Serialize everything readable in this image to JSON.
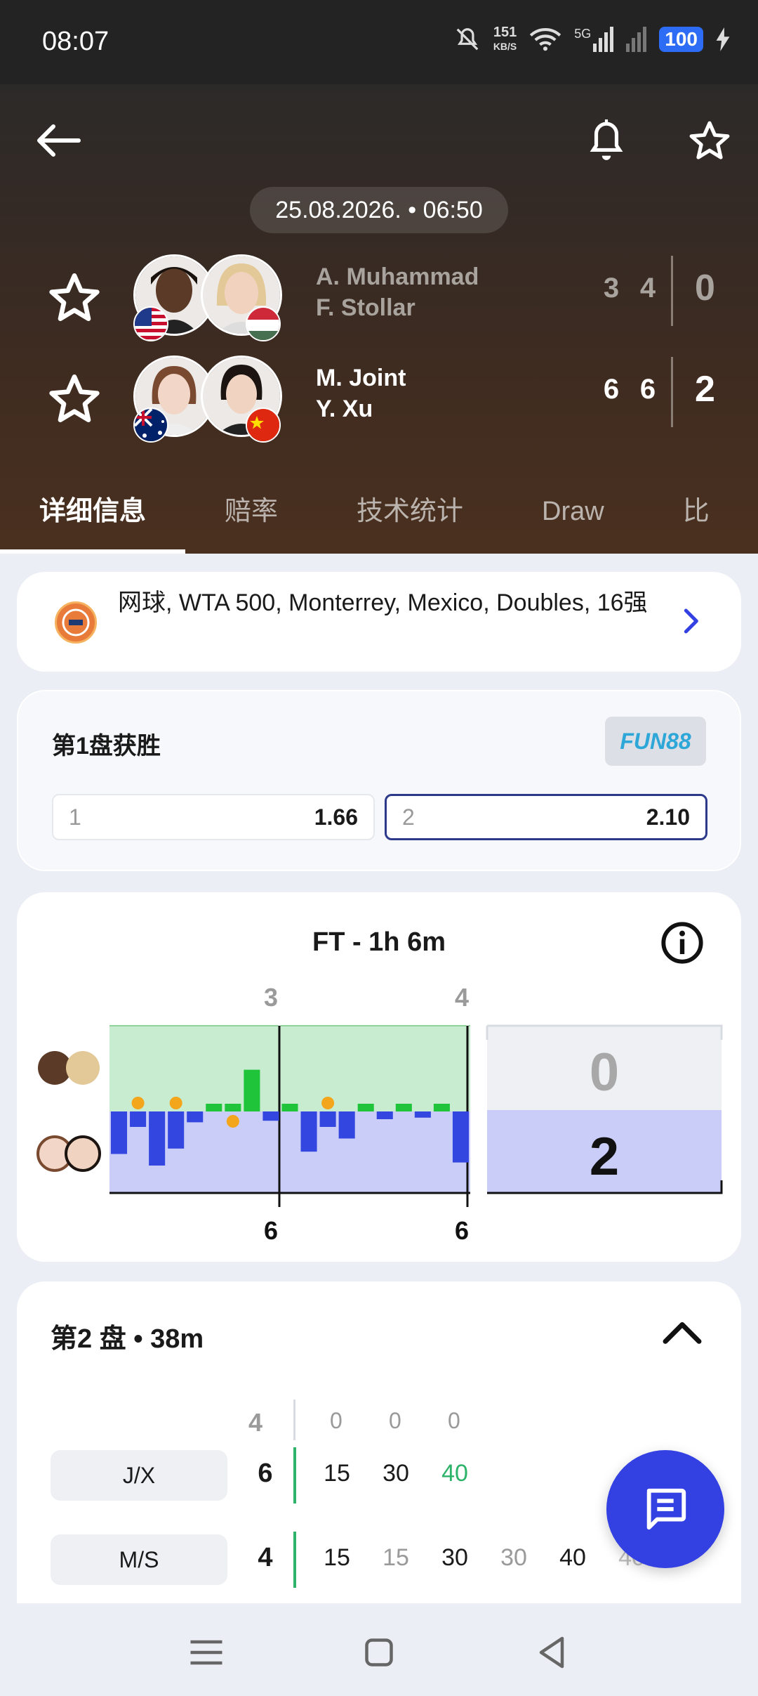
{
  "status_bar": {
    "time": "08:07",
    "net_speed": "151",
    "net_unit": "KB/S",
    "network": "5G",
    "battery": "100"
  },
  "header": {
    "date": "25.08.2026. • 06:50",
    "team1": {
      "player1": "A. Muhammad",
      "player2": "F. Stollar",
      "games": [
        "3",
        "4"
      ],
      "sets": "0"
    },
    "team2": {
      "player1": "M. Joint",
      "player2": "Y. Xu",
      "games": [
        "6",
        "6"
      ],
      "sets": "2"
    }
  },
  "tabs": [
    "详细信息",
    "赔率",
    "技术统计",
    "Draw",
    "比"
  ],
  "league": {
    "text": "网球, WTA 500, Monterrey, Mexico, Doubles, 16强"
  },
  "odds": {
    "title": "第1盘获胜",
    "bookmaker": "FUN88",
    "options": [
      {
        "label": "1",
        "value": "1.66"
      },
      {
        "label": "2",
        "value": "2.10"
      }
    ]
  },
  "momentum": {
    "title": "FT - 1h 6m",
    "set_top_scores": [
      "3",
      "4"
    ],
    "set_bottom_scores": [
      "6",
      "6"
    ],
    "total_top": "0",
    "total_bottom": "2",
    "colors": {
      "top": "#c8ecd0",
      "bottom": "#c9cdf7",
      "top_bar": "#1fc43b",
      "bottom_bar": "#3346e0",
      "serve": "#f3a51b"
    },
    "bars": [
      -0.55,
      -0.2,
      -0.7,
      -0.48,
      -0.14,
      0.1,
      0.1,
      0.54,
      -0.12,
      0.1,
      -0.52,
      -0.2,
      -0.35,
      0.1,
      -0.1,
      0.1,
      -0.08,
      0.1,
      -0.66
    ]
  },
  "set_detail": {
    "title": "第2 盘 • 38m",
    "header_score": "4",
    "header_points": [
      "0",
      "0",
      "0"
    ],
    "rows": [
      {
        "team": "J/X",
        "games": "6",
        "points": [
          "15",
          "30",
          "40"
        ]
      },
      {
        "team": "M/S",
        "games": "4",
        "points": [
          "15",
          "15",
          "30",
          "30",
          "40",
          "40"
        ]
      }
    ]
  }
}
